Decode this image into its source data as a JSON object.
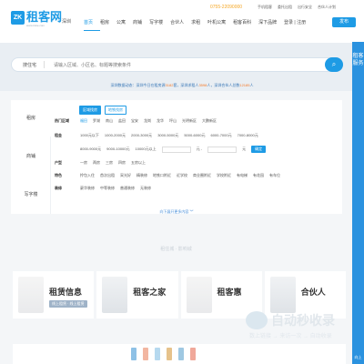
{
  "header": {
    "logo_mark": "ZK",
    "logo_name": "租客网",
    "logo_url": "www.zuke.com",
    "city": "深圳",
    "phone": "0755-22090000",
    "links": [
      "手机租客",
      "委托出租",
      "出行安全",
      "合伙人计划"
    ],
    "nav": [
      "首页",
      "租房",
      "公寓",
      "商铺",
      "写字楼",
      "合伙人",
      "求租",
      "叶机公寓",
      "租客百科",
      "深下品牌"
    ],
    "login": "登录 | 注册",
    "publish": "发布"
  },
  "search": {
    "type": "搜住宅",
    "placeholder": "请输入区域、小区名、标题等搜索条件",
    "button_icon": "search-icon"
  },
  "ticker": {
    "prefix": "深圳数据动态：深圳今日在租房源",
    "count1": "3182",
    "mid1": "套，深圳求租人",
    "count2": "3598",
    "mid2": "人，深圳合伙人总数",
    "count3": "12185",
    "suffix": "人"
  },
  "filter": {
    "tabs": [
      "租房",
      "商铺",
      "写字楼"
    ],
    "subtabs": [
      "区域找房",
      "地铁找房"
    ],
    "rows": [
      {
        "label": "热门区域",
        "items": [
          "福田",
          "罗湖",
          "南山",
          "盐田",
          "宝安",
          "龙岗",
          "龙华",
          "坪山",
          "光明新区",
          "大鹏新区"
        ]
      },
      {
        "label": "租金",
        "items": [
          "1000元以下",
          "1000-2000元",
          "2000-3000元",
          "3000-5000元",
          "5000-6000元",
          "6000-7000元",
          "7000-8000元"
        ]
      },
      {
        "label": "",
        "items": [
          "8000-9000元",
          "9000-10000元",
          "10000元以上",
          "元 -",
          "元",
          "确定"
        ]
      },
      {
        "label": "户型",
        "items": [
          "一房",
          "两房",
          "三房",
          "四房",
          "五房以上"
        ]
      },
      {
        "label": "特色",
        "items": [
          "拎包入住",
          "首次出租",
          "采光好",
          "精装修",
          "地铁口附近",
          "近学校",
          "商业圈附近",
          "学校附近",
          "有电梯",
          "有花园",
          "有车位"
        ]
      },
      {
        "label": "装修",
        "items": [
          "豪华装修",
          "中等装修",
          "普通装修",
          "无装修"
        ]
      }
    ],
    "more": "向下展开更多内容 ︾"
  },
  "section_title": "租住城 · 影响城",
  "cards": [
    {
      "title": "租赁信息",
      "tag": "线上租赁 · 线上租赁"
    },
    {
      "title": "租客之家",
      "tag": ""
    },
    {
      "title": "租客惠",
      "tag": ""
    },
    {
      "title": "合伙人",
      "tag": ""
    }
  ],
  "side_float": {
    "label": "租客服务",
    "bottom": "向上"
  },
  "watermark": {
    "text": "自动秒收录",
    "sub": "数上链接 → 来访一次 → 自动收录"
  },
  "colors": {
    "brand": "#1e9be5",
    "highlight": "#f57c2c",
    "phone": "#f5a623"
  }
}
